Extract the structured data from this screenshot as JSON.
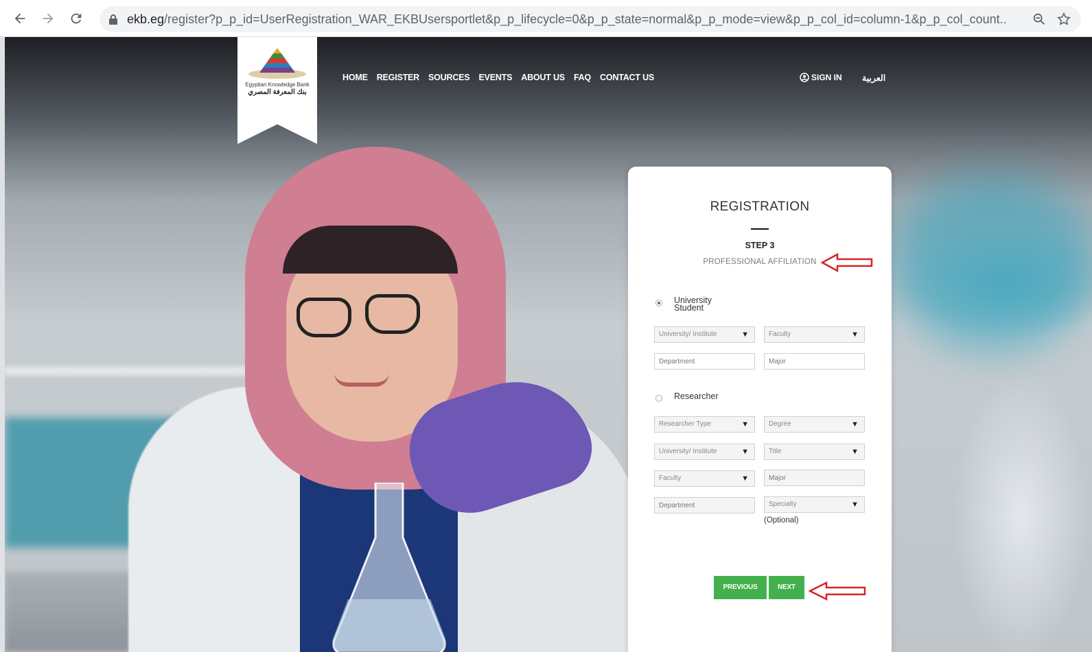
{
  "browser": {
    "url_host": "ekb.eg",
    "url_rest": "/register?p_p_id=UserRegistration_WAR_EKBUsersportlet&p_p_lifecycle=0&p_p_state=normal&p_p_mode=view&p_p_col_id=column-1&p_p_col_count...",
    "icons": [
      "back-arrow-icon",
      "forward-arrow-icon",
      "reload-icon",
      "lock-icon",
      "zoom-icon",
      "star-icon"
    ]
  },
  "logo": {
    "en": "Egyptian Knowledge Bank",
    "ar": "بنك المعرفة المصري"
  },
  "nav": {
    "items": [
      "HOME",
      "REGISTER",
      "SOURCES",
      "EVENTS",
      "ABOUT US",
      "FAQ",
      "CONTACT US"
    ],
    "signin": "SIGN IN",
    "language": "العربية"
  },
  "form": {
    "title": "REGISTRATION",
    "step": "STEP 3",
    "step_subtitle": "PROFESSIONAL AFFILIATION",
    "student": {
      "label_line1": "University",
      "label_line2": "Student",
      "university": "University/ Institute",
      "faculty": "Faculty",
      "department": "Department",
      "major": "Major"
    },
    "researcher": {
      "label": "Researcher",
      "type": "Researcher Type",
      "degree": "Degree",
      "university": "University/ Institute",
      "title": "Title",
      "faculty": "Faculty",
      "major": "Major",
      "department": "Department",
      "specialty": "Specialty",
      "optional": "(Optional)"
    },
    "buttons": {
      "previous": "PREVIOUS",
      "next": "NEXT"
    }
  },
  "colors": {
    "button_green": "#44b04d",
    "annotation_red": "#d42525"
  }
}
